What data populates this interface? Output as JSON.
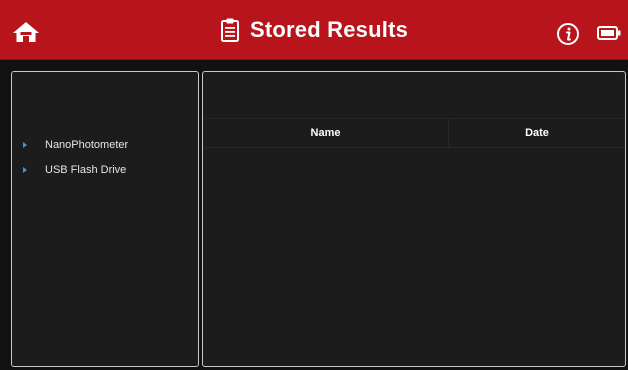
{
  "header": {
    "title": "Stored Results",
    "background_color": "#b8141c",
    "icons": [
      "home-icon",
      "clipboard-icon",
      "info-icon",
      "battery-icon"
    ]
  },
  "sidebar": {
    "items": [
      {
        "label": "NanoPhotometer",
        "icon": "triangle-right-icon"
      },
      {
        "label": "USB Flash Drive",
        "icon": "triangle-right-icon"
      }
    ],
    "accent_color": "#3a9bd8"
  },
  "results_table": {
    "columns": [
      "Name",
      "Date"
    ],
    "rows": []
  }
}
